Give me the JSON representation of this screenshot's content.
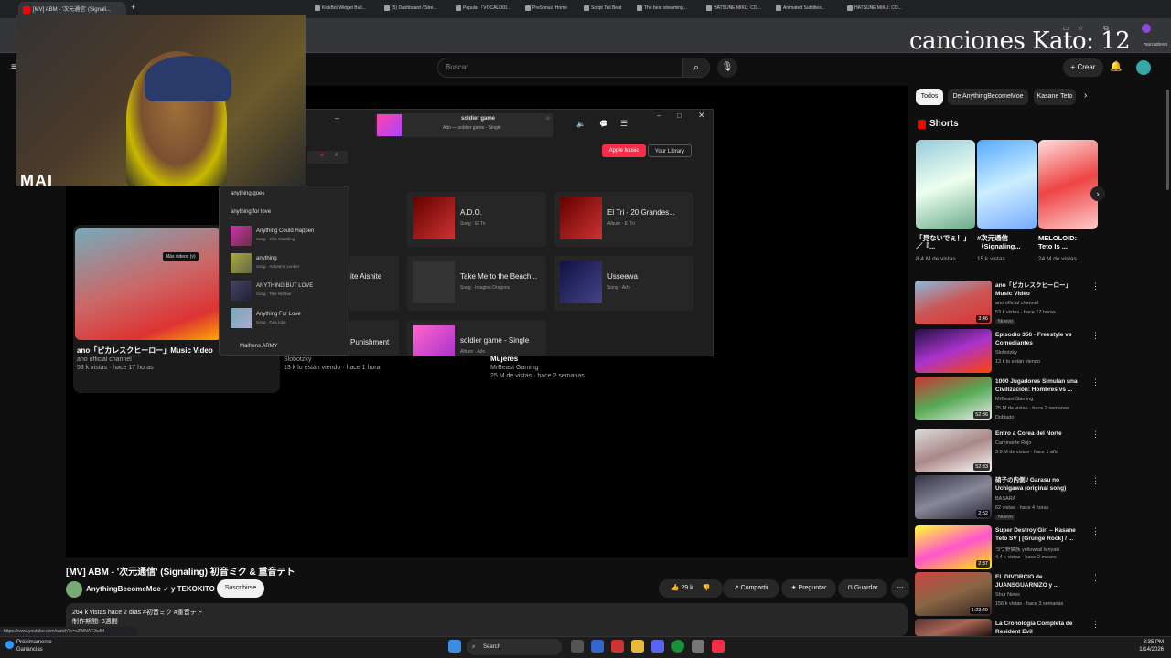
{
  "browser": {
    "tab_title": "[MV] ABM - '次元通信' (Signali...",
    "url_hint": "https://www.youtube.com/watch?v=s2WNAF2w54",
    "bookmarks": [
      "KickBot Widget Buil...",
      "(5) Dashboard / Stre...",
      "Popular「VOCALOID...",
      "PreSonus: Home",
      "Script Tail Beat",
      "The best streaming...",
      "HATSUNE MIKU: CO...",
      "Animated Subtitles...",
      "HATSUNE MIKU: CO..."
    ],
    "bookmarks_folder": "marcadores"
  },
  "overlay": {
    "kato": "canciones Kato: 12",
    "webcam_label": "MAI"
  },
  "youtube": {
    "search_placeholder": "Buscar",
    "create_label": "Crear",
    "video_title": "[MV] ABM - '次元通信' (Signaling) 初音ミク & 重音テト",
    "channel": "AnythingBecomeMoe",
    "channel_suffix": "y TEKOKITO",
    "subscribe": "Suscribirse",
    "likes": "29 k",
    "share": "Compartir",
    "ask": "Preguntar",
    "save": "Guardar",
    "desc_line1": "264 k vistas  hace 2 días  #初音ミク #重音テト",
    "desc_line2": "制作期間: 3週間",
    "more_videos_tooltip": "Más videos (v)",
    "grid": [
      {
        "title": "ano「ピカレスクヒーロー」Music Video",
        "channel": "ano official channel",
        "meta": "53 k vistas · hace 17 horas"
      },
      {
        "title": "Slobotzky",
        "meta": "13 k lo están viendo · hace 1 hora"
      },
      {
        "title": "Mujeres",
        "channel": "MrBeast Gaming",
        "meta": "25 M de vistas · hace 2 semanas"
      }
    ]
  },
  "music_app": {
    "now_playing_title": "soldier game",
    "now_playing_sub": "Ado — soldier game - Single",
    "apple_music": "Apple Music",
    "your_library": "Your Library",
    "results": [
      {
        "title": "A.D.O.",
        "sub": "Song · El Tri"
      },
      {
        "title": "El Tri - 20 Grandes...",
        "sub": "Album · El Tri"
      },
      {
        "title": "ite Aishite",
        "sub": ""
      },
      {
        "title": "Take Me to the Beach...",
        "sub": "Song · Imagine Dragons"
      },
      {
        "title": "Usseewa",
        "sub": "Song · Ado"
      },
      {
        "title": "Punishment",
        "sub": ""
      },
      {
        "title": "soldier game - Single",
        "sub": "Album · Ado"
      }
    ],
    "suggestions": [
      "anything goes",
      "anything for love"
    ],
    "song_suggestions": [
      {
        "title": "Anything Could Happen",
        "sub": "Song · Ellie Goulding"
      },
      {
        "title": "anything",
        "sub": "Song · Adrianne Lenker"
      },
      {
        "title": "ANYTHING BUT LOVE",
        "sub": "Song · Tate McRae"
      },
      {
        "title": "Anything For Love",
        "sub": "Song · Dua Lipa"
      }
    ],
    "artist_suggestion": "Maifrens ARMY"
  },
  "sidebar": {
    "chips": [
      "Todos",
      "De AnythingBecomeMoe",
      "Kasane Teto"
    ],
    "shorts_label": "Shorts",
    "shorts": [
      {
        "title": "「見ないでぇ！」／『...",
        "views": "8.4 M de vistas"
      },
      {
        "title": "#次元通信（Signaling...",
        "views": "15 k vistas"
      },
      {
        "title": "MELOLOID: Teto Is ...",
        "views": "24 M de vistas"
      }
    ],
    "videos": [
      {
        "title": "ano「ピカレスクヒーロー」Music Video",
        "channel": "ano official channel",
        "meta": "53 k vistas · hace 17 horas",
        "badge": "Nuevo",
        "duration": "3:46"
      },
      {
        "title": "Episodio 356 - Freestyle vs Comediantes",
        "channel": "Slobotzky",
        "meta": "13 k lo están viendo",
        "badge": "",
        "duration": ""
      },
      {
        "title": "1000 Jugadores Simulan una Civilización: Hombres vs ...",
        "channel": "MrBeast Gaming",
        "meta": "25 M de vistas · hace 2 semanas",
        "badge": "Doblado",
        "duration": "52:36"
      },
      {
        "title": "Entro a Corea del Norte",
        "channel": "Caminante Rojo",
        "meta": "3.9 M de vistas · hace 1 año",
        "badge": "",
        "duration": "52:33"
      },
      {
        "title": "硝子の内側 / Garasu no Uchigawa (original song)",
        "channel": "BASARA",
        "meta": "62 vistas · hace 4 horas",
        "badge": "Nuevo",
        "duration": "2:52"
      },
      {
        "title": "Super Destroy Girl – Kasane Teto SV | [Grunge Rock] / ...",
        "channel": "ヨウ野猫族  yellowtail teriyaki",
        "meta": "4.4 k vistas · hace 2 meses",
        "badge": "",
        "duration": "2:37"
      },
      {
        "title": "EL DIVORCIO de JUANSGUARNIZO y ...",
        "channel": "Shur News",
        "meta": "156 k vistas · hace 3 semanas",
        "badge": "",
        "duration": "1:23:49"
      },
      {
        "title": "La Cronología Completa de Resident Evil",
        "channel": "",
        "meta": "",
        "badge": "",
        "duration": ""
      }
    ]
  },
  "taskbar": {
    "weather": "Próximamente",
    "weather_sub": "Ganancias",
    "search": "Search",
    "time": "8:35 PM",
    "date": "1/14/2026"
  }
}
